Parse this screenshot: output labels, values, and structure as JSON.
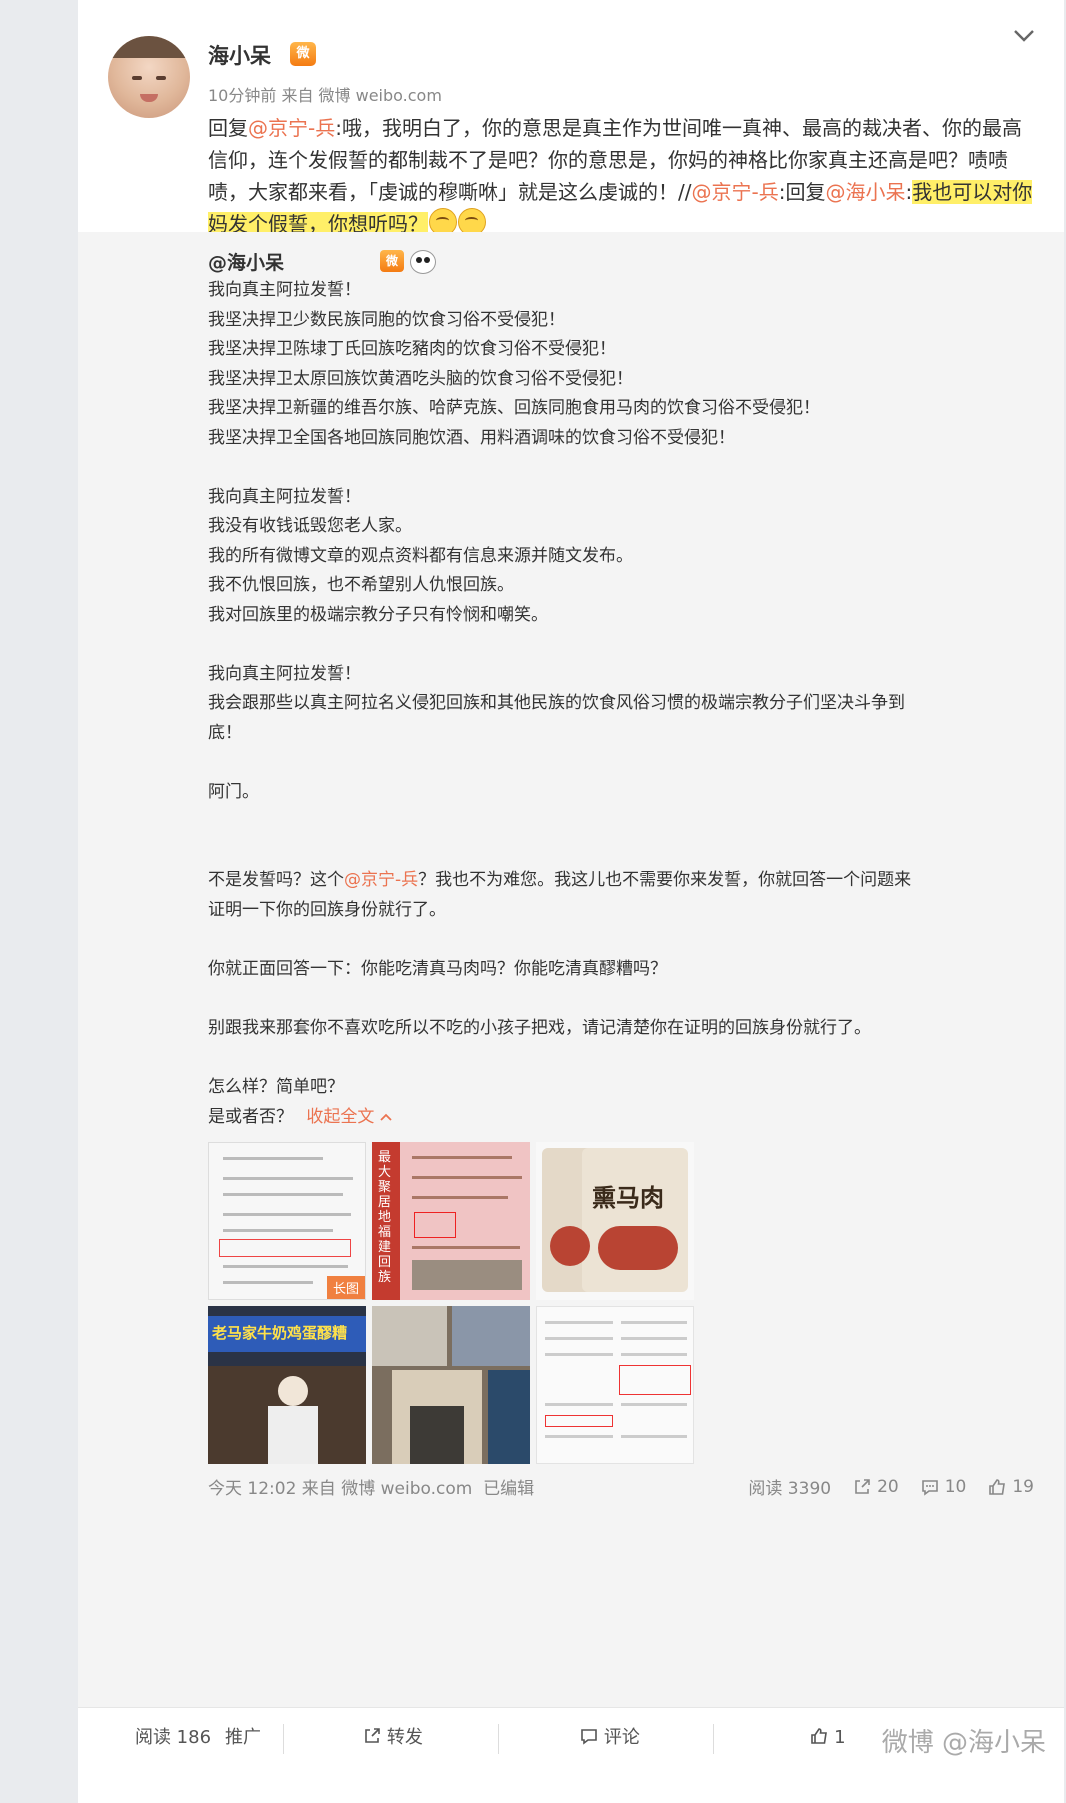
{
  "post": {
    "author": "海小呆",
    "vip_badge": "微",
    "meta": "10分钟前 来自 微博 weibo.com",
    "reply": {
      "p1": "回复",
      "m1": "@京宁-兵",
      "p2": ":哦，我明白了，你的意思是真主作为世间唯一真神、最高的裁决者、你的最高信仰，连个发假誓的都制裁不了是吧？你的意思是，你妈的神格比你家真主还高是吧？啧啧啧，大家都来看，「虔诚的穆嘶咻」就是这么虔诚的！//",
      "m2": "@京宁-兵",
      "p3": ":回复",
      "m3": "@海小呆",
      "p4": ":",
      "highlight": "我也可以对你妈发个假誓，你想听吗？"
    }
  },
  "repost": {
    "author": "@海小呆",
    "lines": [
      "我向真主阿拉发誓！",
      "我坚决捍卫少数民族同胞的饮食习俗不受侵犯！",
      "我坚决捍卫陈埭丁氏回族吃豬肉的饮食习俗不受侵犯！",
      "我坚决捍卫太原回族饮黄酒吃头脑的饮食习俗不受侵犯！",
      "我坚决捍卫新疆的维吾尔族、哈萨克族、回族同胞食用马肉的饮食习俗不受侵犯！",
      "我坚决捍卫全国各地回族同胞饮酒、用料酒调味的饮食习俗不受侵犯！",
      "",
      "我向真主阿拉发誓！",
      "我没有收钱诋毁您老人家。",
      "我的所有微博文章的观点资料都有信息来源并随文发布。",
      "我不仇恨回族，也不希望别人仇恨回族。",
      "我对回族里的极端宗教分子只有怜悯和嘲笑。",
      "",
      "我向真主阿拉发誓！",
      "我会跟那些以真主阿拉名义侵犯回族和其他民族的饮食风俗习惯的极端宗教分子们坚决斗争到",
      "底！",
      "",
      "阿门。",
      "",
      "",
      "",
      "证明一下你的回族身份就行了。",
      "",
      "你就正面回答一下：你能吃清真马肉吗？你能吃清真醪糟吗？",
      "",
      "别跟我来那套你不喜欢吃所以不吃的小孩子把戏，请记清楚你在证明的回族身份就行了。",
      "",
      "怎么样？简单吧？"
    ],
    "q_pre": "不是发誓吗？这个",
    "q_mention": "@京宁-兵",
    "q_post": "？我也不为难您。我这儿也不需要你来发誓，你就回答一个问题来",
    "end_q": "是或者否？",
    "fold": "收起全文",
    "long_badge": "长图",
    "thumb3_text": "熏马肉",
    "thumb4_text": "老马家牛奶鸡蛋醪糟",
    "thumb5_text": "最大聚居地 福建回族",
    "foot_meta": "今天 12:02 来自 微博 weibo.com  已编辑",
    "reads": "阅读 3390",
    "reposts": "20",
    "comments": "10",
    "likes": "19"
  },
  "bottom": {
    "reads": "阅读 186",
    "promote": "推广",
    "repost": "转发",
    "comment": "评论",
    "like": "1"
  },
  "watermark": "微博 @海小呆",
  "colors": {
    "link": "#eb7350",
    "highlight": "#ffef68",
    "repost_bg": "#f4f4f4"
  }
}
